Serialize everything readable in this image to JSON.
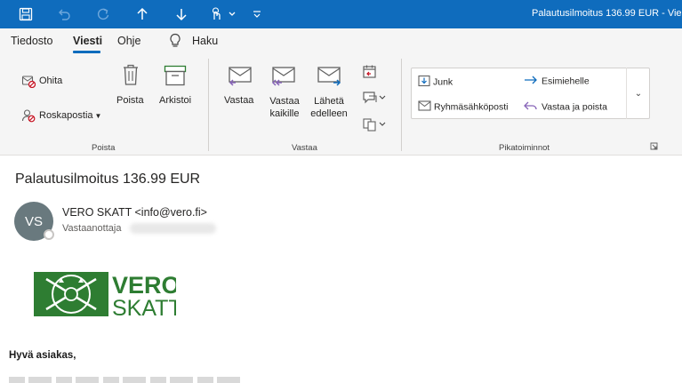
{
  "window": {
    "title": "Palautusilmoitus 136.99 EUR - Vie"
  },
  "tabs": [
    {
      "label": "Tiedosto"
    },
    {
      "label": "Viesti"
    },
    {
      "label": "Ohje"
    }
  ],
  "search": {
    "label": "Haku"
  },
  "ribbon": {
    "delete_group": {
      "label": "Poista",
      "ignore": "Ohita",
      "junk": "Roskapostia",
      "delete": "Poista",
      "archive": "Arkistoi"
    },
    "respond_group": {
      "label": "Vastaa",
      "reply": "Vastaa",
      "reply_all_line1": "Vastaa",
      "reply_all_line2": "kaikille",
      "forward_line1": "Lähetä",
      "forward_line2": "edelleen"
    },
    "quicksteps_group": {
      "label": "Pikatoiminnot",
      "items": [
        {
          "label": "Junk"
        },
        {
          "label": "Esimiehelle"
        },
        {
          "label": "Ryhmäsähköposti"
        },
        {
          "label": "Vastaa ja poista"
        }
      ]
    }
  },
  "message": {
    "subject": "Palautusilmoitus 136.99 EUR",
    "avatar_initials": "VS",
    "sender": "VERO SKATT <info@vero.fi>",
    "to_label": "Vastaanottaja",
    "logo_line1": "VERO",
    "logo_line2": "SKATT",
    "greeting": "Hyvä asiakas,"
  },
  "colors": {
    "accent": "#0f6cbd",
    "logo_green": "#2e7d32",
    "avatar": "#69797e"
  }
}
